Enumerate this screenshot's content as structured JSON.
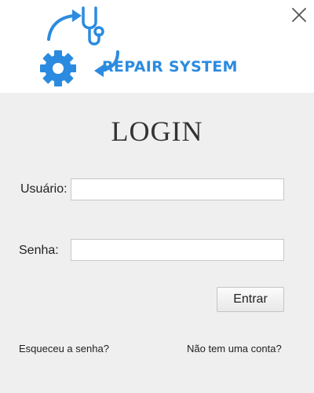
{
  "header": {
    "logo_text": "REPAIR SYSTEM",
    "brand_color": "#2b8be0",
    "icons": [
      "stethoscope-icon",
      "gear-icon",
      "cycle-arrows-icon",
      "close-icon"
    ]
  },
  "login": {
    "title": "LOGIN",
    "username_label": "Usuário:",
    "username_value": "",
    "password_label": "Senha:",
    "password_value": "",
    "submit_label": "Entrar",
    "forgot_password_link": "Esqueceu a senha?",
    "signup_link": "Não tem uma conta?"
  }
}
